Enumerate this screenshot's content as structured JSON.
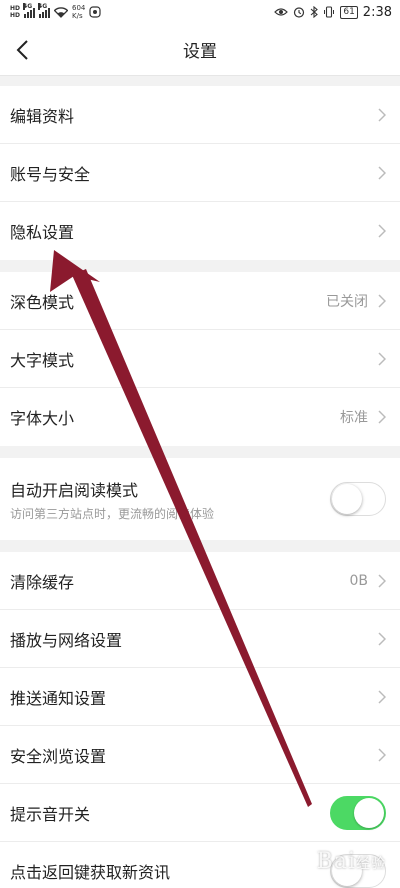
{
  "status_bar": {
    "hd_label": "HD",
    "net1": "4G",
    "net2": "4G",
    "speed_value": "604",
    "speed_unit": "K/s",
    "battery": "61",
    "time": "2:38",
    "icons": [
      "eye-icon",
      "alarm-icon",
      "bluetooth-icon",
      "vibrate-icon"
    ]
  },
  "nav": {
    "title": "设置",
    "back_icon": "chevron-left-icon"
  },
  "group1": {
    "items": [
      {
        "label": "编辑资料"
      },
      {
        "label": "账号与安全"
      },
      {
        "label": "隐私设置"
      }
    ]
  },
  "group2": {
    "items": [
      {
        "label": "深色模式",
        "value": "已关闭"
      },
      {
        "label": "大字模式",
        "value": ""
      },
      {
        "label": "字体大小",
        "value": "标准"
      }
    ]
  },
  "group3": {
    "title": "自动开启阅读模式",
    "subtitle": "访问第三方站点时，更流畅的阅读体验",
    "toggle_on": false
  },
  "group4": {
    "items": [
      {
        "label": "清除缓存",
        "value": "0B"
      },
      {
        "label": "播放与网络设置"
      },
      {
        "label": "推送通知设置"
      },
      {
        "label": "安全浏览设置"
      },
      {
        "label": "提示音开关",
        "toggle_on": true
      },
      {
        "label": "点击返回键获取新资讯",
        "toggle_on": false
      }
    ]
  },
  "watermark": {
    "brand": "Bai",
    "suffix": "经验"
  },
  "colors": {
    "arrow": "#8b1a2e",
    "toggle_on": "#4cd964",
    "background": "#f2f2f2"
  }
}
